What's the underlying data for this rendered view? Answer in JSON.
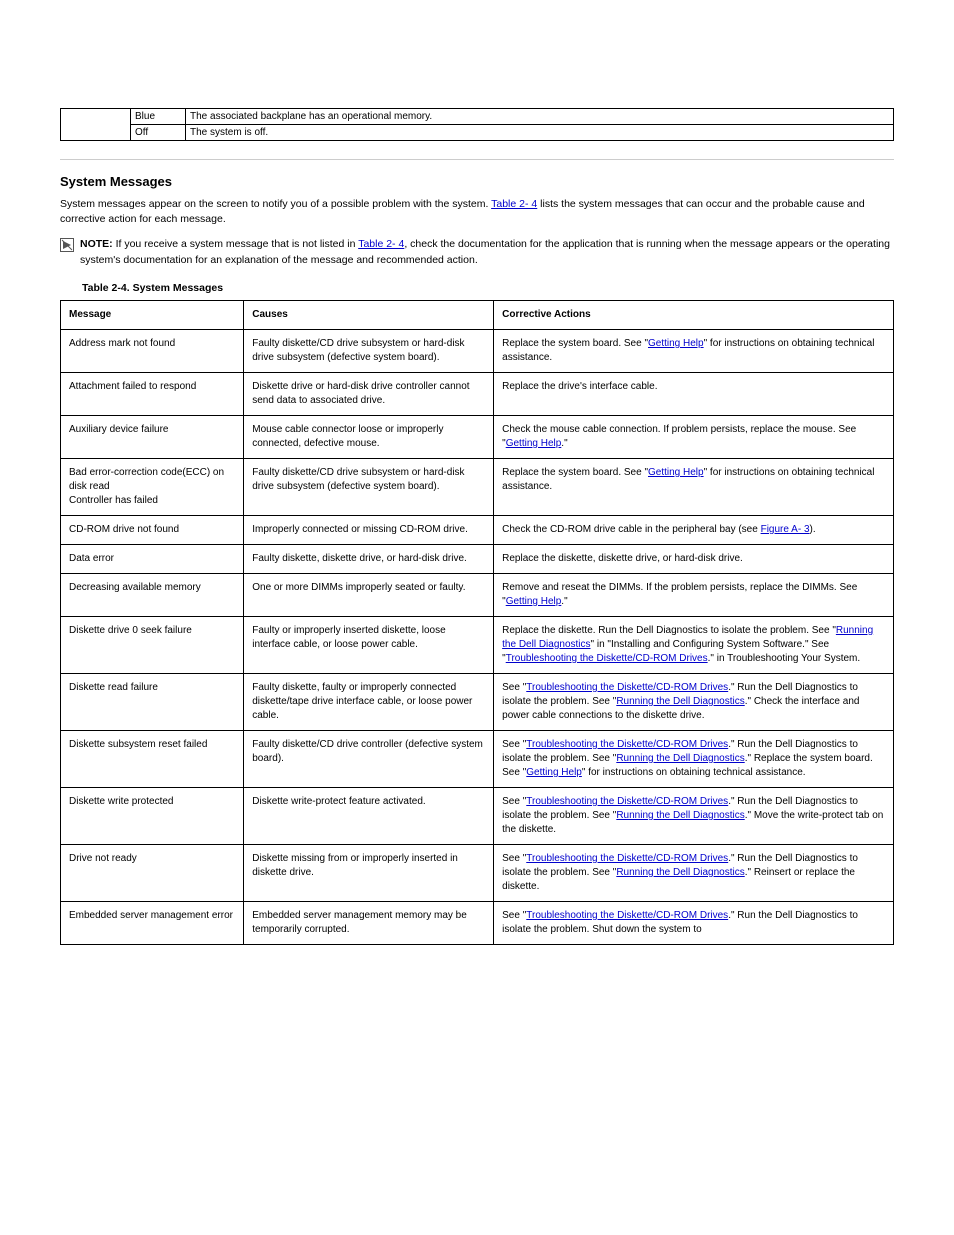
{
  "top_table": {
    "rows": [
      {
        "c2": "Blue",
        "c3": "The associated backplane has an operational memory."
      },
      {
        "c2": "Off",
        "c3": "The system is off."
      }
    ]
  },
  "section_title": "System Messages",
  "intro_para_pre": "System messages appear on the screen to notify you of a possible problem with the system. ",
  "intro_link": "Table 2- 4",
  "intro_para_post": " lists the system messages that can occur and the probable cause and corrective action for each message.",
  "note_prefix": "NOTE:",
  "note_pre": " If you receive a system message that is not listed in ",
  "note_link": "Table 2- 4",
  "note_post": ", check the documentation for the application that is running when the message appears or the operating system's documentation for an explanation of the message and recommended action.",
  "table_caption_prefix": "Table 2-",
  "table_caption_rest": "4. System Messages",
  "headers": {
    "c1": "Message",
    "c2": "Causes",
    "c3": "Corrective Actions"
  },
  "rows": [
    {
      "msg": "Address mark not found",
      "cause": "Faulty diskette/CD drive subsystem or hard-disk drive subsystem (defective system board).",
      "action_parts": [
        {
          "t": "text",
          "v": "Replace the system board. See \""
        },
        {
          "t": "link",
          "v": "Getting Help"
        },
        {
          "t": "text",
          "v": "\" for instructions on obtaining technical assistance."
        }
      ]
    },
    {
      "msg": "Attachment failed to respond",
      "cause": "Diskette drive or hard-disk drive controller cannot send data to associated drive.",
      "action_parts": [
        {
          "t": "text",
          "v": "Replace the drive's interface cable."
        }
      ]
    },
    {
      "msg": "Auxiliary device failure",
      "cause": "Mouse cable connector loose or improperly connected, defective mouse.",
      "action_parts": [
        {
          "t": "text",
          "v": "Check the mouse cable connection. If problem persists, replace the mouse. See \""
        },
        {
          "t": "link",
          "v": "Getting Help"
        },
        {
          "t": "text",
          "v": ".\""
        }
      ]
    },
    {
      "msg": "Bad error-correction code(ECC) on disk read\nController has failed",
      "cause": "Faulty diskette/CD drive subsystem or hard-disk drive subsystem (defective system board).",
      "action_parts": [
        {
          "t": "text",
          "v": "Replace the system board. See \""
        },
        {
          "t": "link",
          "v": "Getting Help"
        },
        {
          "t": "text",
          "v": "\" for instructions on obtaining technical assistance."
        }
      ]
    },
    {
      "msg": "CD-ROM drive not found",
      "cause": "Improperly connected or missing CD-ROM drive.",
      "action_parts": [
        {
          "t": "text",
          "v": "Check the CD-ROM drive cable in the peripheral bay (see "
        },
        {
          "t": "link",
          "v": "Figure A- 3"
        },
        {
          "t": "text",
          "v": ")."
        }
      ]
    },
    {
      "msg": "Data error",
      "cause": "Faulty diskette, diskette drive, or hard-disk drive.",
      "action_parts": [
        {
          "t": "text",
          "v": "Replace the diskette, diskette drive, or hard-disk drive."
        }
      ]
    },
    {
      "msg": "Decreasing available memory",
      "cause": "One or more DIMMs improperly seated or faulty.",
      "action_parts": [
        {
          "t": "text",
          "v": "Remove and reseat the DIMMs. If the problem persists, replace the DIMMs. See \""
        },
        {
          "t": "link",
          "v": "Getting Help"
        },
        {
          "t": "text",
          "v": ".\""
        }
      ]
    },
    {
      "msg": "Diskette drive 0 seek failure",
      "cause": "Faulty or improperly inserted diskette, loose interface cable, or loose power cable.",
      "action_parts": [
        {
          "t": "text",
          "v": "Replace the diskette. Run the Dell Diagnostics to isolate the problem. See \""
        },
        {
          "t": "link",
          "v": "Running the Dell Diagnostics"
        },
        {
          "t": "text",
          "v": "\" in \"Installing and Configuring System Software.\" See \""
        },
        {
          "t": "link",
          "v": "Troubleshooting the Diskette/CD-ROM Drives"
        },
        {
          "t": "text",
          "v": ".\" in Troubleshooting Your System."
        }
      ]
    },
    {
      "msg": "Diskette read failure",
      "cause": "Faulty diskette, faulty or improperly connected diskette/tape drive interface cable, or loose power cable.",
      "action_parts": [
        {
          "t": "text",
          "v": "See \""
        },
        {
          "t": "link",
          "v": "Troubleshooting the Diskette/CD-ROM Drives"
        },
        {
          "t": "text",
          "v": ".\" Run the Dell Diagnostics to isolate the problem. See \""
        },
        {
          "t": "link",
          "v": "Running the Dell Diagnostics"
        },
        {
          "t": "text",
          "v": ".\" Check the interface and power cable connections to the diskette drive."
        }
      ]
    },
    {
      "msg": "Diskette subsystem reset failed",
      "cause": "Faulty diskette/CD drive controller (defective system board).",
      "action_parts": [
        {
          "t": "text",
          "v": "See \""
        },
        {
          "t": "link",
          "v": "Troubleshooting the Diskette/CD-ROM Drives"
        },
        {
          "t": "text",
          "v": ".\" Run the Dell Diagnostics to isolate the problem. See \""
        },
        {
          "t": "link",
          "v": "Running the Dell Diagnostics"
        },
        {
          "t": "text",
          "v": ".\" Replace the system board. See \""
        },
        {
          "t": "link",
          "v": "Getting Help"
        },
        {
          "t": "text",
          "v": "\" for instructions on obtaining technical assistance."
        }
      ]
    },
    {
      "msg": "Diskette write protected",
      "cause": "Diskette write-protect feature activated.",
      "action_parts": [
        {
          "t": "text",
          "v": "See \""
        },
        {
          "t": "link",
          "v": "Troubleshooting the Diskette/CD-ROM Drives"
        },
        {
          "t": "text",
          "v": ".\" Run the Dell Diagnostics to isolate the problem. See \""
        },
        {
          "t": "link",
          "v": "Running the Dell Diagnostics"
        },
        {
          "t": "text",
          "v": ".\" Move the write-protect tab on the diskette."
        }
      ]
    },
    {
      "msg": "Drive not ready",
      "cause": "Diskette missing from or improperly inserted in diskette drive.",
      "action_parts": [
        {
          "t": "text",
          "v": "See \""
        },
        {
          "t": "link",
          "v": "Troubleshooting the Diskette/CD-ROM Drives"
        },
        {
          "t": "text",
          "v": ".\" Run the Dell Diagnostics to isolate the problem. See \""
        },
        {
          "t": "link",
          "v": "Running the Dell Diagnostics"
        },
        {
          "t": "text",
          "v": ".\" Reinsert or replace the diskette."
        }
      ]
    },
    {
      "msg": "Embedded server management error",
      "cause": "Embedded server management memory may be temporarily corrupted.",
      "action_parts": [
        {
          "t": "text",
          "v": "See \""
        },
        {
          "t": "link",
          "v": "Troubleshooting the Diskette/CD-ROM Drives"
        },
        {
          "t": "text",
          "v": ".\" Run the Dell Diagnostics to isolate the problem. Shut down the system to"
        }
      ]
    }
  ]
}
